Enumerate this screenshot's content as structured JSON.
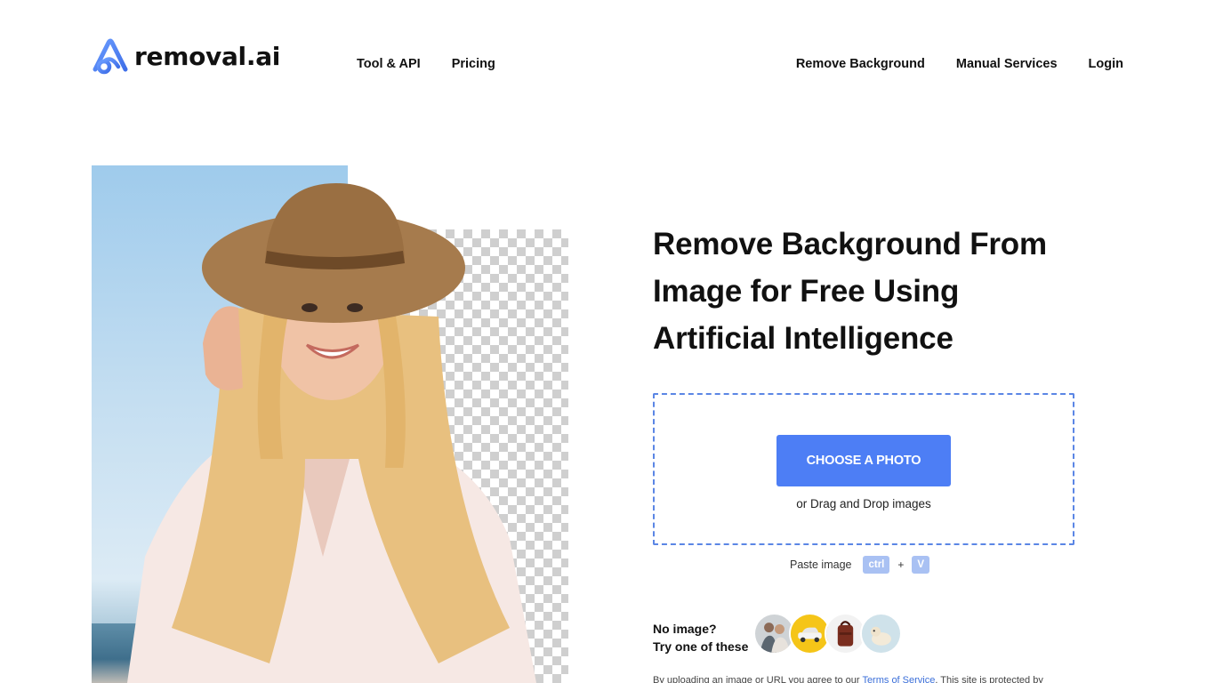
{
  "header": {
    "logo_text": "removal.ai",
    "logo_icon": "removal-ai-logo-icon",
    "nav_left": [
      {
        "label": "Tool & API"
      },
      {
        "label": "Pricing"
      }
    ],
    "nav_right": [
      {
        "label": "Remove Background"
      },
      {
        "label": "Manual Services"
      },
      {
        "label": "Login"
      }
    ]
  },
  "hero": {
    "headline_lines": [
      "Remove Background From",
      "Image for Free Using",
      "Artificial Intelligence"
    ]
  },
  "upload": {
    "choose_button": "CHOOSE A PHOTO",
    "drag_text": "or Drag and Drop images",
    "paste_label": "Paste image",
    "key_ctrl": "ctrl",
    "key_plus": "+",
    "key_v": "V"
  },
  "samples": {
    "prompt_line1": "No image?",
    "prompt_line2": "Try one of these",
    "items": [
      {
        "name": "sample-people-icon"
      },
      {
        "name": "sample-car-icon"
      },
      {
        "name": "sample-bag-icon"
      },
      {
        "name": "sample-dog-icon"
      }
    ]
  },
  "legal": {
    "prefix": "By uploading an image or URL you agree to our ",
    "tos_link": "Terms of Service",
    "suffix": ". This site is protected by"
  },
  "colors": {
    "accent": "#4d7ef5",
    "dropzone_border": "#5b86e5",
    "key_bg": "#a9c1f3",
    "text": "#111111"
  }
}
